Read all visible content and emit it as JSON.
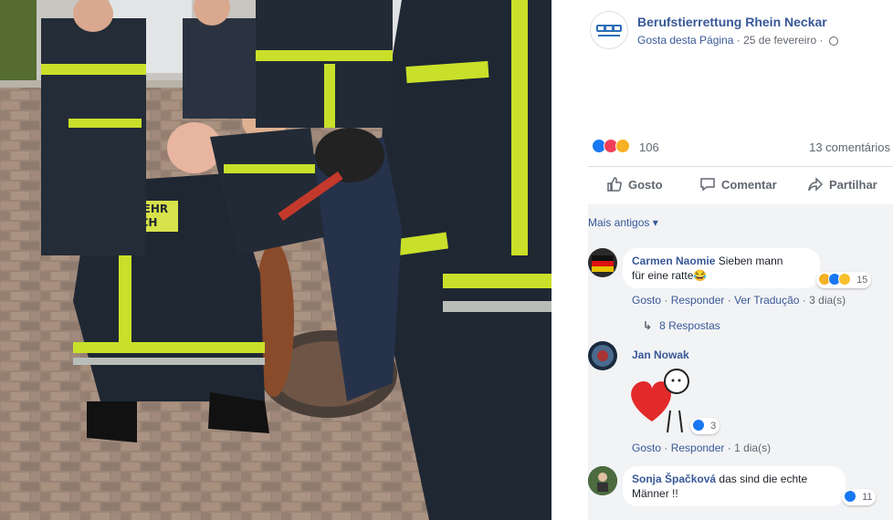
{
  "post": {
    "page_name": "Berufstierrettung Rhein Neckar",
    "like_page_link": "Gosta desta Página",
    "date": "25 de fevereiro",
    "separator": "·",
    "reaction_count": "106",
    "comment_count": "13 comentários"
  },
  "actions": {
    "like_label": "Gosto",
    "comment_label": "Comentar",
    "share_label": "Partilhar"
  },
  "comments_section": {
    "more_label": "Mais antigos"
  },
  "comments": [
    {
      "author": "Carmen Naomie",
      "text_line1": "Sieben mann",
      "text_line2": "für eine ratte😂",
      "reactions": "15",
      "like": "Gosto",
      "reply": "Responder",
      "translate": "Ver Tradução",
      "time": "3 dia(s)",
      "replies": "8 Respostas"
    },
    {
      "author": "Jan Nowak",
      "reactions": "3",
      "like": "Gosto",
      "reply": "Responder",
      "time": "1 dia(s)"
    },
    {
      "author": "Sonja Špačková",
      "text_line1": "das sind die echte",
      "text_line2": "Männer !!",
      "reactions": "11"
    }
  ],
  "photo": {
    "jacket_text_1": "EUERWEHR",
    "jacket_text_2": "ÜERBACH"
  },
  "colors": {
    "link_blue": "#385898",
    "like_blue": "#1877f2",
    "love_red": "#f33e58",
    "haha_yellow": "#f7b125",
    "reflective_yellow": "#c9e02a"
  }
}
